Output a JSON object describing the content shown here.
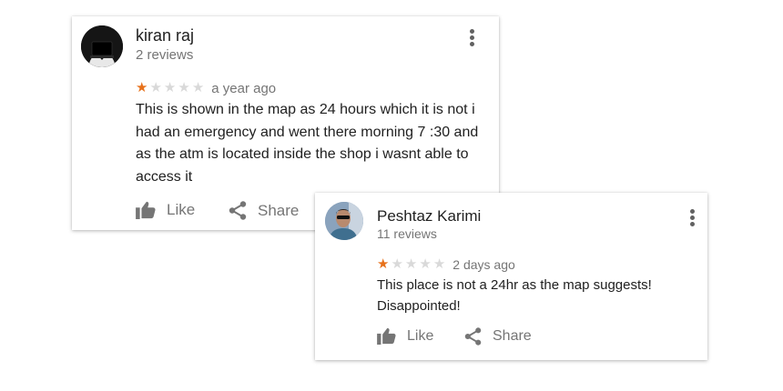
{
  "reviews": [
    {
      "author": "kiran raj",
      "review_count": "2 reviews",
      "rating": 1,
      "max_rating": 5,
      "time_ago": "a year ago",
      "text": "This is shown in the map as 24 hours which it is not i had an emergency and went there morning 7 :30  and as the atm is located inside the shop i wasnt able to access it",
      "like_label": "Like",
      "share_label": "Share"
    },
    {
      "author": "Peshtaz Karimi",
      "review_count": "11 reviews",
      "rating": 1,
      "max_rating": 5,
      "time_ago": "2 days ago",
      "text": "This place is not a 24hr as the map suggests! Disappointed!",
      "like_label": "Like",
      "share_label": "Share"
    }
  ],
  "colors": {
    "star_filled": "#e7711b",
    "star_empty": "#d9d9d9",
    "secondary_text": "#757575",
    "primary_text": "#212121"
  },
  "icons": [
    "thumbs-up-icon",
    "share-icon",
    "more-vert-icon",
    "star-icon"
  ]
}
